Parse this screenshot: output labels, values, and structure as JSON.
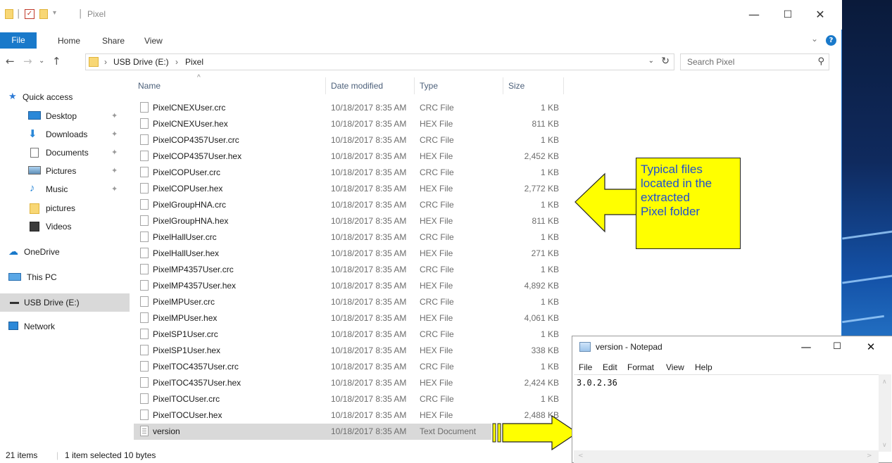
{
  "window": {
    "title": "Pixel",
    "controls": {
      "minimize": "—",
      "maximize": "☐",
      "close": "✕"
    }
  },
  "ribbon": {
    "tabs": [
      "File",
      "Home",
      "Share",
      "View"
    ],
    "help": "?"
  },
  "address": {
    "breadcrumb": [
      "USB Drive (E:)",
      "Pixel"
    ],
    "search_placeholder": "Search Pixel"
  },
  "nav_pane": {
    "items": [
      {
        "label": "Quick access",
        "icon": "star-icon",
        "pinned": false
      },
      {
        "label": "Desktop",
        "icon": "desktop-icon",
        "pinned": true
      },
      {
        "label": "Downloads",
        "icon": "downloads-icon",
        "pinned": true
      },
      {
        "label": "Documents",
        "icon": "documents-icon",
        "pinned": true
      },
      {
        "label": "Pictures",
        "icon": "pictures-icon",
        "pinned": true
      },
      {
        "label": "Music",
        "icon": "music-icon",
        "pinned": true
      },
      {
        "label": "pictures",
        "icon": "folder-icon",
        "pinned": false
      },
      {
        "label": "Videos",
        "icon": "videos-icon",
        "pinned": false
      },
      {
        "label": "OneDrive",
        "icon": "cloud-icon",
        "pinned": false
      },
      {
        "label": "This PC",
        "icon": "computer-icon",
        "pinned": false
      },
      {
        "label": "USB Drive (E:)",
        "icon": "drive-icon",
        "pinned": false,
        "selected": true
      },
      {
        "label": "Network",
        "icon": "network-icon",
        "pinned": false
      }
    ]
  },
  "file_list": {
    "columns": [
      "Name",
      "Date modified",
      "Type",
      "Size"
    ],
    "files": [
      {
        "name": "PixelCNEXUser.crc",
        "date": "10/18/2017 8:35 AM",
        "type": "CRC File",
        "size": "1 KB"
      },
      {
        "name": "PixelCNEXUser.hex",
        "date": "10/18/2017 8:35 AM",
        "type": "HEX File",
        "size": "811 KB"
      },
      {
        "name": "PixelCOP4357User.crc",
        "date": "10/18/2017 8:35 AM",
        "type": "CRC File",
        "size": "1 KB"
      },
      {
        "name": "PixelCOP4357User.hex",
        "date": "10/18/2017 8:35 AM",
        "type": "HEX File",
        "size": "2,452 KB"
      },
      {
        "name": "PixelCOPUser.crc",
        "date": "10/18/2017 8:35 AM",
        "type": "CRC File",
        "size": "1 KB"
      },
      {
        "name": "PixelCOPUser.hex",
        "date": "10/18/2017 8:35 AM",
        "type": "HEX File",
        "size": "2,772 KB"
      },
      {
        "name": "PixelGroupHNA.crc",
        "date": "10/18/2017 8:35 AM",
        "type": "CRC File",
        "size": "1 KB"
      },
      {
        "name": "PixelGroupHNA.hex",
        "date": "10/18/2017 8:35 AM",
        "type": "HEX File",
        "size": "811 KB"
      },
      {
        "name": "PixelHallUser.crc",
        "date": "10/18/2017 8:35 AM",
        "type": "CRC File",
        "size": "1 KB"
      },
      {
        "name": "PixelHallUser.hex",
        "date": "10/18/2017 8:35 AM",
        "type": "HEX File",
        "size": "271 KB"
      },
      {
        "name": "PixelMP4357User.crc",
        "date": "10/18/2017 8:35 AM",
        "type": "CRC File",
        "size": "1 KB"
      },
      {
        "name": "PixelMP4357User.hex",
        "date": "10/18/2017 8:35 AM",
        "type": "HEX File",
        "size": "4,892 KB"
      },
      {
        "name": "PixelMPUser.crc",
        "date": "10/18/2017 8:35 AM",
        "type": "CRC File",
        "size": "1 KB"
      },
      {
        "name": "PixelMPUser.hex",
        "date": "10/18/2017 8:35 AM",
        "type": "HEX File",
        "size": "4,061 KB"
      },
      {
        "name": "PixelSP1User.crc",
        "date": "10/18/2017 8:35 AM",
        "type": "CRC File",
        "size": "1 KB"
      },
      {
        "name": "PixelSP1User.hex",
        "date": "10/18/2017 8:35 AM",
        "type": "HEX File",
        "size": "338 KB"
      },
      {
        "name": "PixelTOC4357User.crc",
        "date": "10/18/2017 8:35 AM",
        "type": "CRC File",
        "size": "1 KB"
      },
      {
        "name": "PixelTOC4357User.hex",
        "date": "10/18/2017 8:35 AM",
        "type": "HEX File",
        "size": "2,424 KB"
      },
      {
        "name": "PixelTOCUser.crc",
        "date": "10/18/2017 8:35 AM",
        "type": "CRC File",
        "size": "1 KB"
      },
      {
        "name": "PixelTOCUser.hex",
        "date": "10/18/2017 8:35 AM",
        "type": "HEX File",
        "size": "2,488 KB"
      },
      {
        "name": "version",
        "date": "10/18/2017 8:35 AM",
        "type": "Text Document",
        "size": "",
        "selected": true
      }
    ]
  },
  "status_bar": {
    "item_count": "21 items",
    "selection": "1 item selected  10 bytes"
  },
  "callout": {
    "text_lines": [
      "Typical files",
      "located in the",
      "extracted",
      "Pixel folder"
    ],
    "box_color": "#ffff00",
    "text_color": "#1f4fd0"
  },
  "notepad": {
    "title": "version - Notepad",
    "menu": [
      "File",
      "Edit",
      "Format",
      "View",
      "Help"
    ],
    "content": "3.0.2.36"
  },
  "colors": {
    "accent": "#1979ca",
    "selection": "#d9d9d9"
  }
}
